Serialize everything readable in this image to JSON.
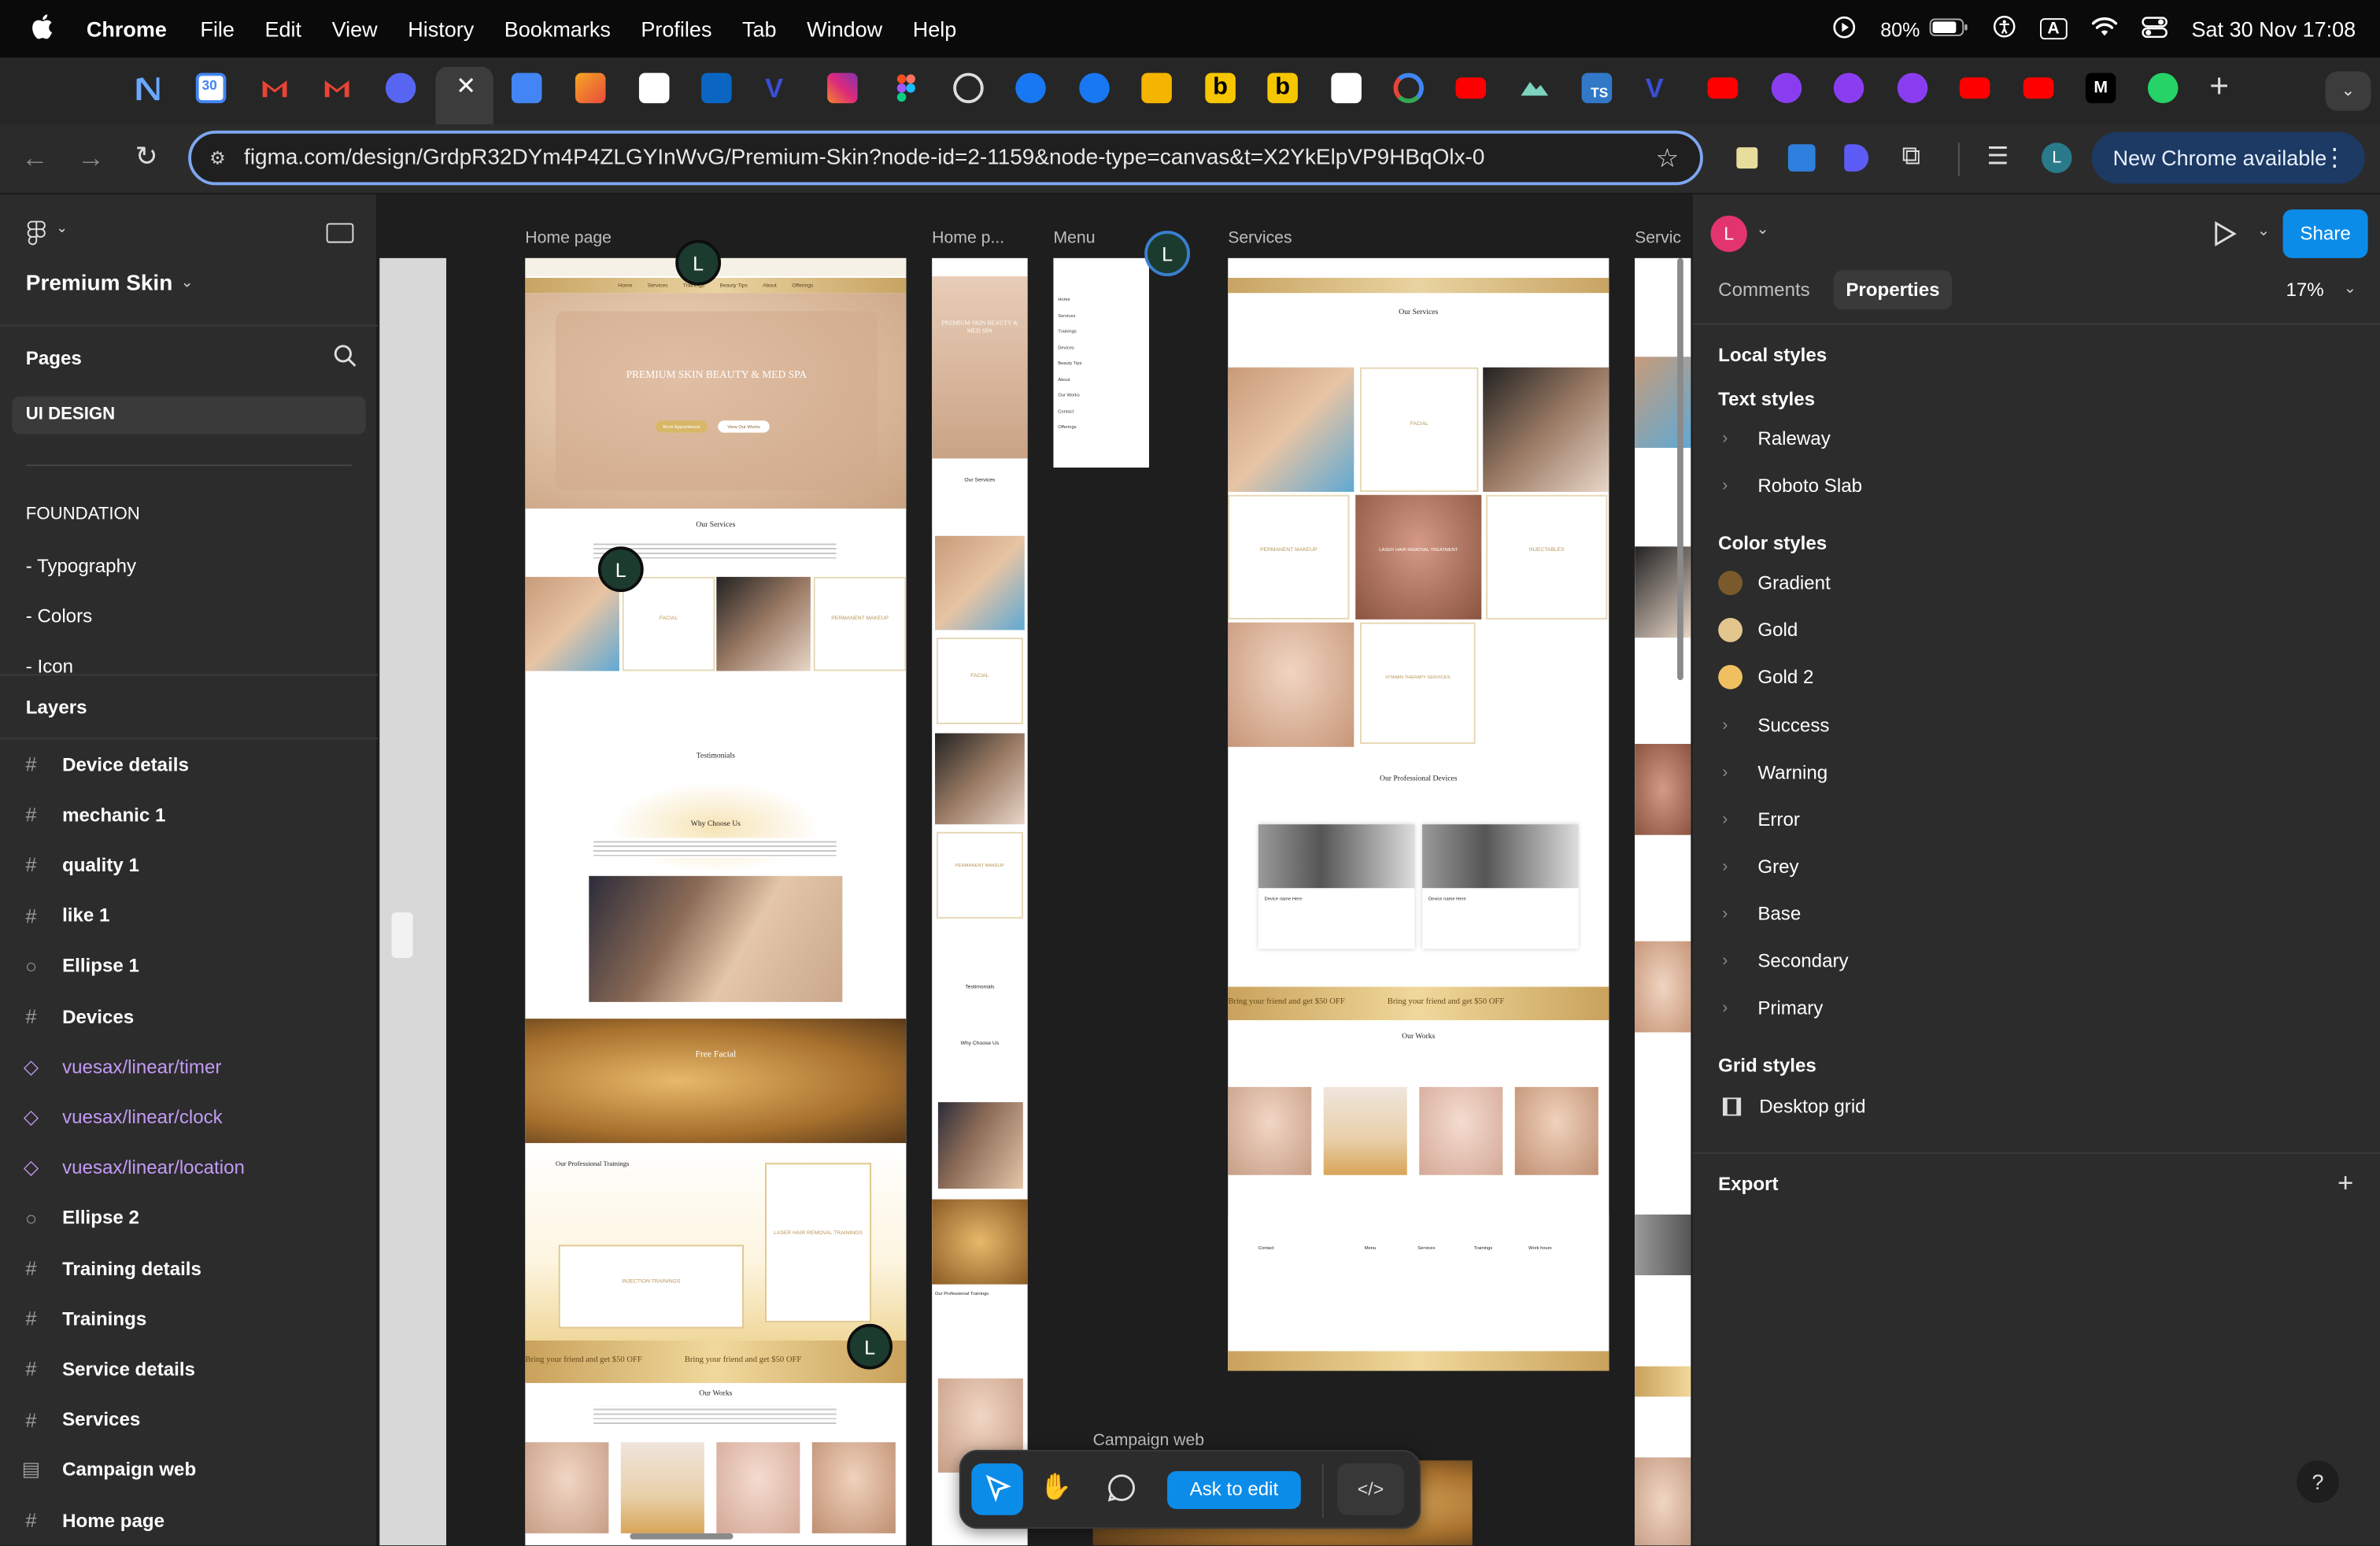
{
  "menubar": {
    "app": "Chrome",
    "items": [
      "File",
      "Edit",
      "View",
      "History",
      "Bookmarks",
      "Profiles",
      "Tab",
      "Window",
      "Help"
    ],
    "battery": "80%",
    "input_indicator": "A",
    "clock": "Sat 30 Nov  17:08"
  },
  "toolbar": {
    "url": "figma.com/design/GrdpR32DYm4P4ZLGYInWvG/Premium-Skin?node-id=2-1159&node-type=canvas&t=X2YkElpVP9HBqOlx-0",
    "new_chrome": "New Chrome available",
    "profile_initial": "L",
    "ext_ts": "TS"
  },
  "left": {
    "file_name": "Premium Skin",
    "pages_title": "Pages",
    "pages": [
      "UI DESIGN",
      "FOUNDATION",
      "- Typography",
      "- Colors",
      "- Icon"
    ],
    "layers_title": "Layers",
    "layers": [
      {
        "name": "Device details",
        "icon": "frame-icon"
      },
      {
        "name": "mechanic 1",
        "icon": "frame-icon"
      },
      {
        "name": "quality 1",
        "icon": "frame-icon"
      },
      {
        "name": "like 1",
        "icon": "frame-icon"
      },
      {
        "name": "Ellipse 1",
        "icon": "ellipse-icon"
      },
      {
        "name": "Devices",
        "icon": "frame-icon"
      },
      {
        "name": "vuesax/linear/timer",
        "icon": "component-icon"
      },
      {
        "name": "vuesax/linear/clock",
        "icon": "component-icon"
      },
      {
        "name": "vuesax/linear/location",
        "icon": "component-icon"
      },
      {
        "name": "Ellipse 2",
        "icon": "ellipse-icon"
      },
      {
        "name": "Training details",
        "icon": "frame-icon"
      },
      {
        "name": "Trainings",
        "icon": "frame-icon"
      },
      {
        "name": "Service details",
        "icon": "frame-icon"
      },
      {
        "name": "Services",
        "icon": "frame-icon"
      },
      {
        "name": "Campaign web",
        "icon": "section-icon"
      },
      {
        "name": "Home page",
        "icon": "frame-icon"
      }
    ],
    "component_color": "#c39bf5"
  },
  "canvas": {
    "frame_labels": {
      "home": "Home page",
      "home_m": "Home p...",
      "menu": "Menu",
      "services": "Services",
      "services2": "Servic",
      "campaign": "Campaign web"
    },
    "cursor_initial": "L",
    "home": {
      "nav": [
        "Home",
        "Services",
        "Trainings",
        "Beauty Tips",
        "About",
        "Offerings"
      ],
      "hero_title": "PREMIUM SKIN BEAUTY & MED SPA",
      "hero_btn1": "Book Appointment",
      "hero_btn2": "View Our Works",
      "our_services": "Our Services",
      "service_cards": [
        "PERMANENT MAKEUP",
        "FACIAL",
        "LASER HAIR R",
        "PERMANENT MAKEUP"
      ],
      "testimonials": "Testimonials",
      "why": "Why Choose Us",
      "free_facial": "Free Facial",
      "trainings": "Our Professional Trainings",
      "injection": "INJECTION TRAININGS",
      "laser_training": "LASER HAIR REMOVAL TRAININGS",
      "promo": "Bring your friend and get $50 OFF",
      "our_works": "Our Works"
    },
    "mobile": {
      "hero_title": "PREMIUM SKIN BEAUTY & MED SPA",
      "our_services": "Our Services",
      "facial": "FACIAL",
      "perm": "PERMANENT MAKEUP",
      "testimonials": "Testimonials",
      "why": "Why Choose Us",
      "trainings": "Our Professional Trainings"
    },
    "menu_items": [
      "Home",
      "Services",
      "Trainings",
      "Devices",
      "Beauty Tips",
      "About",
      "Our Works",
      "Contact",
      "Offerings"
    ],
    "services": {
      "title": "Our Services",
      "cards": [
        "PERMANENT MAKEUP",
        "FACIAL",
        "LASER HAIR RE",
        "PERMANENT MAKEUP",
        "LASER HAIR REMOVAL TREATMENT",
        "INJECTABLES",
        "",
        "VITAMIN THERAPY SERVICES"
      ],
      "devices": "Our Professional Devices",
      "device_name": "Device name Here",
      "promo": "Bring your friend and get $50 OFF",
      "works": "Our Works",
      "footer_cols": [
        "Contact",
        "Menu",
        "Services",
        "Trainings",
        "Work hours"
      ]
    }
  },
  "right": {
    "avatar": "L",
    "share": "Share",
    "tabs": [
      "Comments",
      "Properties"
    ],
    "zoom": "17%",
    "local_styles": "Local styles",
    "text_styles": "Text styles",
    "text_items": [
      "Raleway",
      "Roboto Slab"
    ],
    "color_styles": "Color styles",
    "color_items": [
      {
        "name": "Gradient",
        "color": "#7a5a2a"
      },
      {
        "name": "Gold",
        "color": "#e3c58e"
      },
      {
        "name": "Gold 2",
        "color": "#f0c060"
      }
    ],
    "color_groups": [
      "Success",
      "Warning",
      "Error",
      "Grey",
      "Base",
      "Secondary",
      "Primary"
    ],
    "grid_styles": "Grid styles",
    "grid_item": "Desktop grid",
    "export": "Export"
  },
  "bottom": {
    "ask_to_edit": "Ask to edit",
    "help": "?"
  },
  "colors": {
    "accent": "#0c8ce9",
    "selection": "#3a3a3a"
  }
}
